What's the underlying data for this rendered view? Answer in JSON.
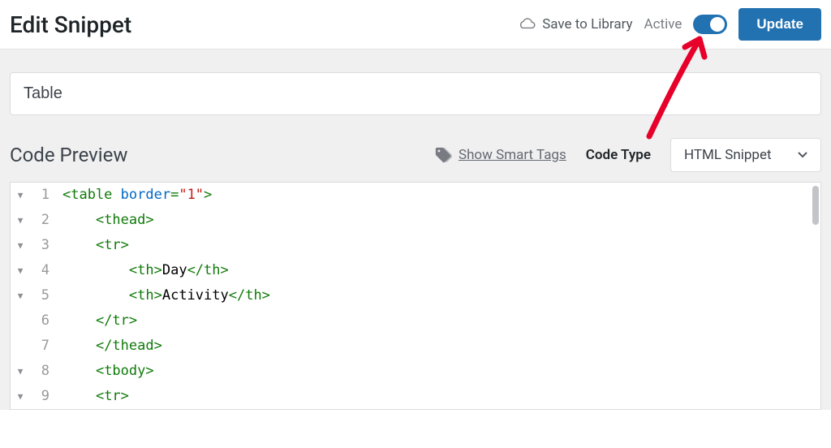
{
  "header": {
    "title": "Edit Snippet",
    "save_library": "Save to Library",
    "active_label": "Active",
    "toggle_on": true,
    "update_button": "Update"
  },
  "snippet": {
    "title": "Table"
  },
  "preview": {
    "heading": "Code Preview",
    "smart_tags": "Show Smart Tags",
    "code_type_label": "Code Type",
    "code_type_selected": "HTML Snippet"
  },
  "code_lines": [
    {
      "n": 1,
      "fold": true,
      "indent": 0,
      "tokens": [
        {
          "t": "tag",
          "v": "<table "
        },
        {
          "t": "attr",
          "v": "border"
        },
        {
          "t": "tag",
          "v": "="
        },
        {
          "t": "string",
          "v": "\"1\""
        },
        {
          "t": "tag",
          "v": ">"
        }
      ]
    },
    {
      "n": 2,
      "fold": true,
      "indent": 1,
      "tokens": [
        {
          "t": "tag",
          "v": "<thead>"
        }
      ]
    },
    {
      "n": 3,
      "fold": true,
      "indent": 1,
      "tokens": [
        {
          "t": "tag",
          "v": "<tr>"
        }
      ]
    },
    {
      "n": 4,
      "fold": true,
      "indent": 2,
      "tokens": [
        {
          "t": "tag",
          "v": "<th>"
        },
        {
          "t": "text",
          "v": "Day"
        },
        {
          "t": "tag",
          "v": "</th>"
        }
      ]
    },
    {
      "n": 5,
      "fold": true,
      "indent": 2,
      "tokens": [
        {
          "t": "tag",
          "v": "<th>"
        },
        {
          "t": "text",
          "v": "Activity"
        },
        {
          "t": "tag",
          "v": "</th>"
        }
      ]
    },
    {
      "n": 6,
      "fold": false,
      "indent": 1,
      "tokens": [
        {
          "t": "tag",
          "v": "</tr>"
        }
      ]
    },
    {
      "n": 7,
      "fold": false,
      "indent": 1,
      "tokens": [
        {
          "t": "tag",
          "v": "</thead>"
        }
      ]
    },
    {
      "n": 8,
      "fold": true,
      "indent": 1,
      "tokens": [
        {
          "t": "tag",
          "v": "<tbody>"
        }
      ]
    },
    {
      "n": 9,
      "fold": true,
      "indent": 1,
      "tokens": [
        {
          "t": "tag",
          "v": "<tr>"
        }
      ]
    }
  ],
  "annotation": {
    "arrow_color": "#e6002a"
  }
}
